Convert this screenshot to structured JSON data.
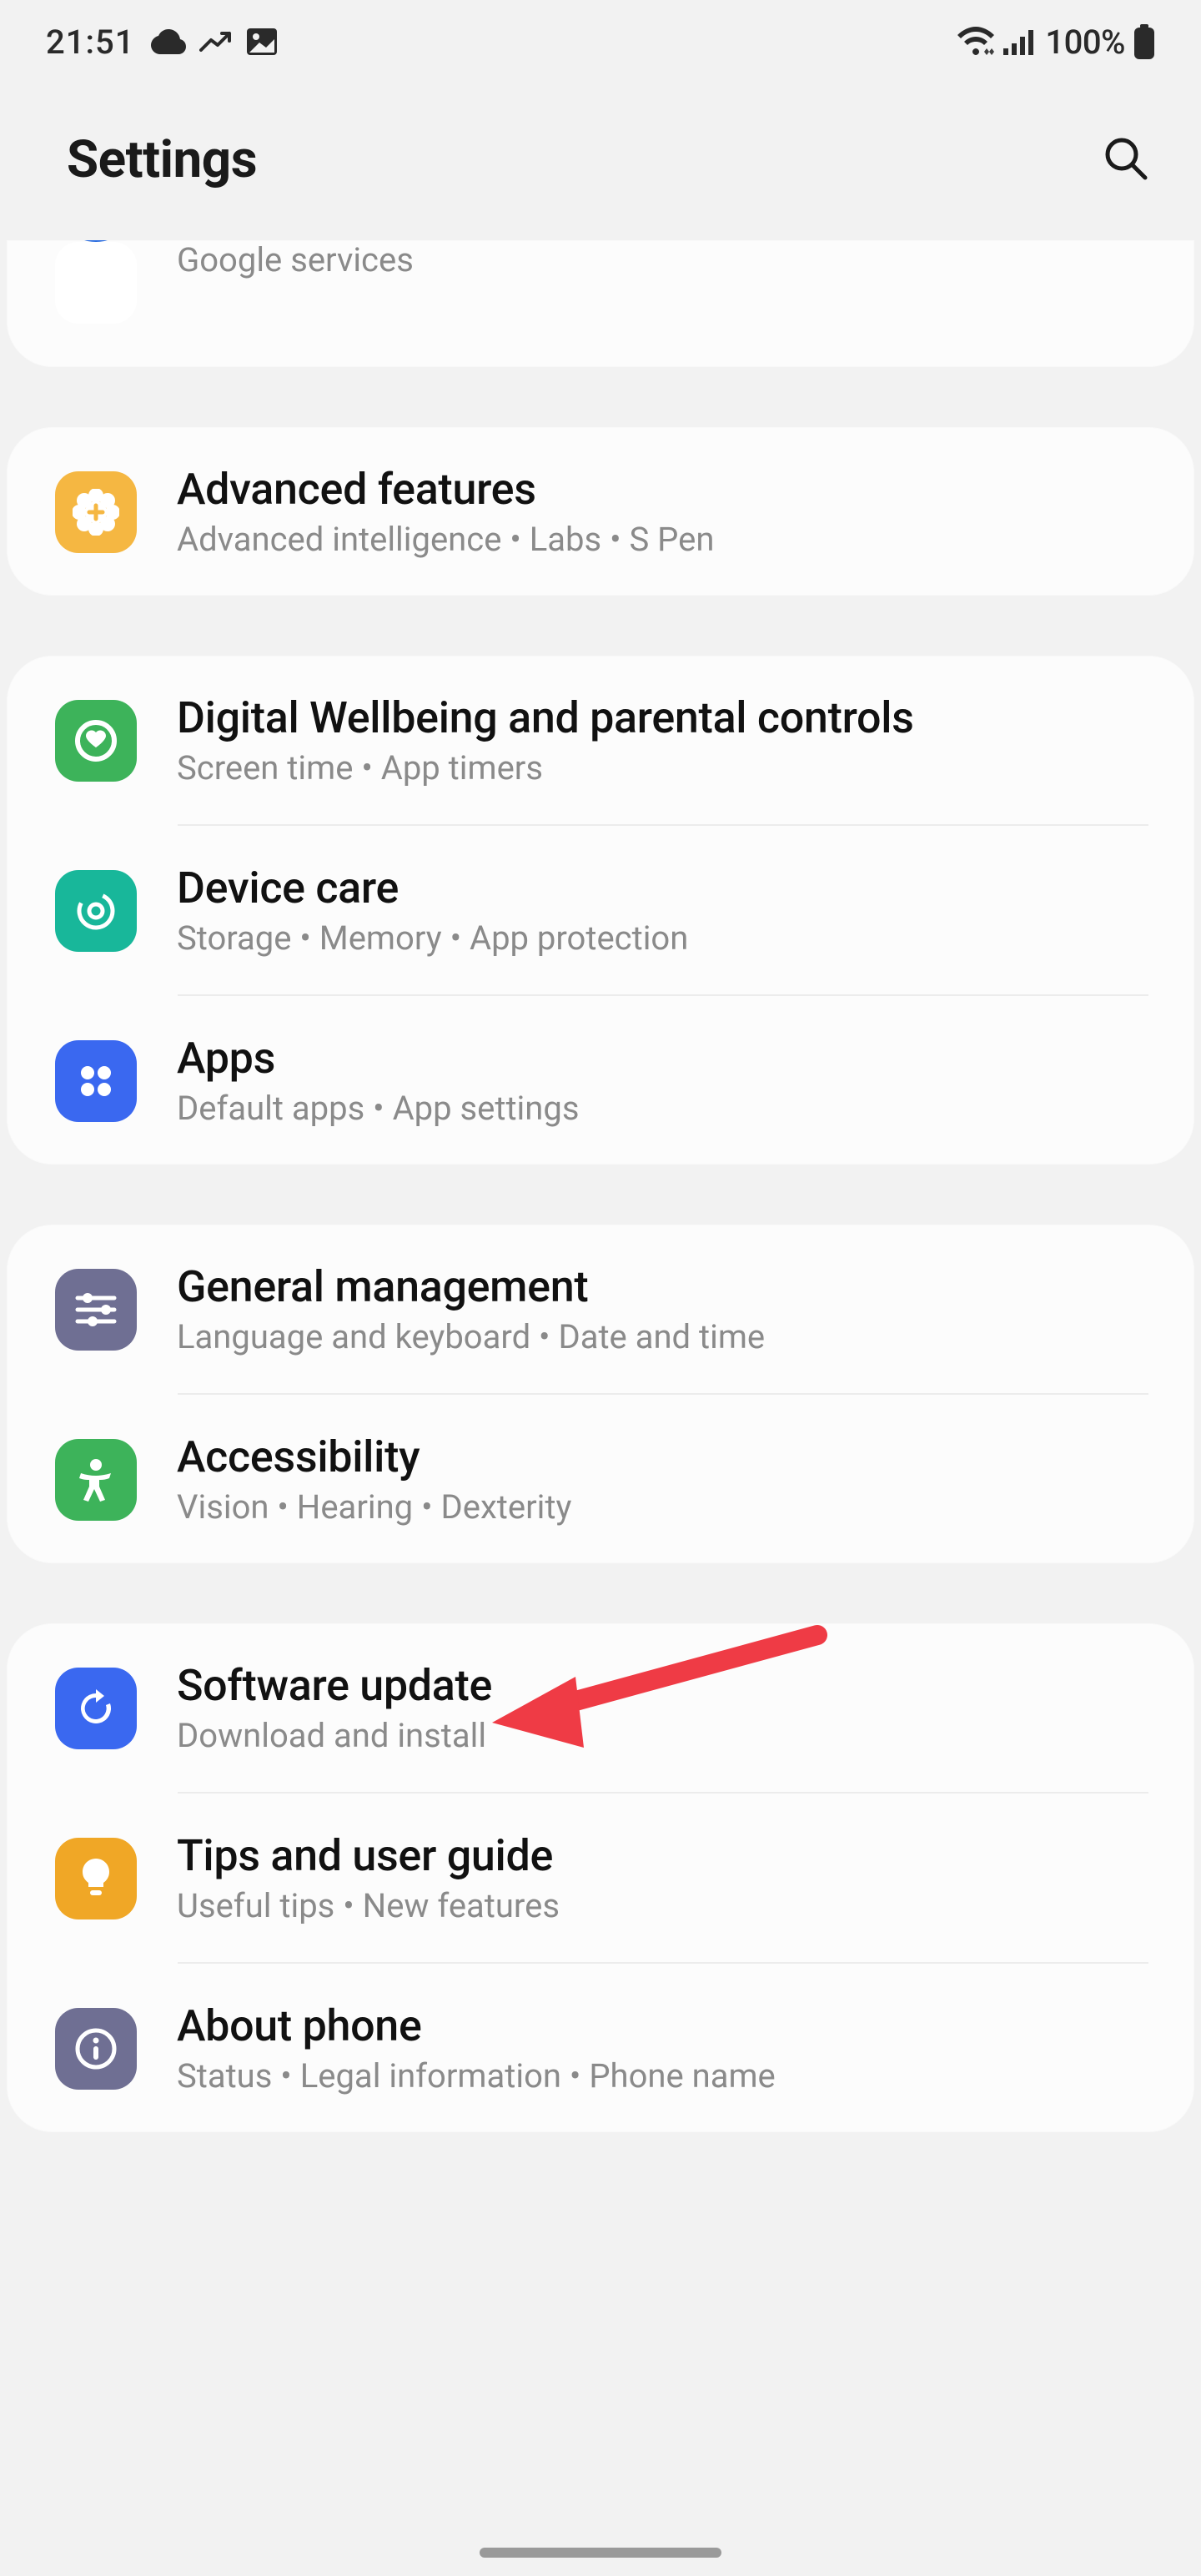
{
  "status": {
    "time": "21:51",
    "battery_text": "100%"
  },
  "header": {
    "title": "Settings"
  },
  "truncated_item": {
    "subtitle": "Google services"
  },
  "groups": [
    {
      "items": [
        {
          "id": "advanced-features",
          "title": "Advanced features",
          "subtitle": "Advanced intelligence  •  Labs  •  S Pen",
          "icon": "plus-flower",
          "bg": "#f5b742"
        }
      ]
    },
    {
      "items": [
        {
          "id": "digital-wellbeing",
          "title": "Digital Wellbeing and parental controls",
          "subtitle": "Screen time  •  App timers",
          "icon": "wellbeing",
          "bg": "#3db35a"
        },
        {
          "id": "device-care",
          "title": "Device care",
          "subtitle": "Storage  •  Memory  •  App protection",
          "icon": "device-care",
          "bg": "#18b79a"
        },
        {
          "id": "apps",
          "title": "Apps",
          "subtitle": "Default apps  •  App settings",
          "icon": "apps",
          "bg": "#3a68f0"
        }
      ]
    },
    {
      "items": [
        {
          "id": "general-management",
          "title": "General management",
          "subtitle": "Language and keyboard  •  Date and time",
          "icon": "sliders",
          "bg": "#6f6f93"
        },
        {
          "id": "accessibility",
          "title": "Accessibility",
          "subtitle": "Vision  •  Hearing  •  Dexterity",
          "icon": "person",
          "bg": "#3db35a"
        }
      ]
    },
    {
      "items": [
        {
          "id": "software-update",
          "title": "Software update",
          "subtitle": "Download and install",
          "icon": "update",
          "bg": "#3a68f0"
        },
        {
          "id": "tips",
          "title": "Tips and user guide",
          "subtitle": "Useful tips  •  New features",
          "icon": "bulb",
          "bg": "#f0a726"
        },
        {
          "id": "about-phone",
          "title": "About phone",
          "subtitle": "Status  •  Legal information  •  Phone name",
          "icon": "info",
          "bg": "#6f6f93"
        }
      ]
    }
  ]
}
